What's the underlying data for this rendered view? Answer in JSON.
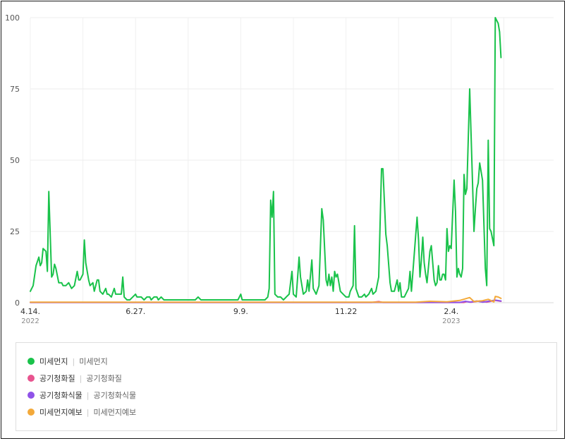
{
  "chart_data": {
    "type": "line",
    "ylim": [
      0,
      100
    ],
    "yticks": [
      "0",
      "25",
      "50",
      "75",
      "100"
    ],
    "grid": true,
    "xrange": [
      "2022-04-14",
      "2023-04-17"
    ],
    "xticks": [
      {
        "date": "2022-04-14",
        "label": "4.14.",
        "year": "2022"
      },
      {
        "date": "2022-06-27",
        "label": "6.27.",
        "year": ""
      },
      {
        "date": "2022-09-09",
        "label": "9.9.",
        "year": ""
      },
      {
        "date": "2022-11-22",
        "label": "11.22",
        "year": ""
      },
      {
        "date": "2023-02-04",
        "label": "2.4.",
        "year": "2023"
      }
    ],
    "series": [
      {
        "name": "미세먼지",
        "color": "#19c24a",
        "points": [
          [
            "2022-04-14",
            4
          ],
          [
            "2022-04-16",
            6
          ],
          [
            "2022-04-18",
            13
          ],
          [
            "2022-04-20",
            16
          ],
          [
            "2022-04-21",
            13
          ],
          [
            "2022-04-22",
            14
          ],
          [
            "2022-04-23",
            19
          ],
          [
            "2022-04-25",
            18
          ],
          [
            "2022-04-26",
            11
          ],
          [
            "2022-04-27",
            39
          ],
          [
            "2022-04-29",
            9
          ],
          [
            "2022-04-30",
            10
          ],
          [
            "2022-05-01",
            13.5
          ],
          [
            "2022-05-02",
            12
          ],
          [
            "2022-05-04",
            7
          ],
          [
            "2022-05-06",
            7
          ],
          [
            "2022-05-07",
            6
          ],
          [
            "2022-05-09",
            6
          ],
          [
            "2022-05-11",
            7
          ],
          [
            "2022-05-13",
            5
          ],
          [
            "2022-05-15",
            6
          ],
          [
            "2022-05-17",
            11
          ],
          [
            "2022-05-18",
            8
          ],
          [
            "2022-05-19",
            8
          ],
          [
            "2022-05-21",
            10
          ],
          [
            "2022-05-22",
            22
          ],
          [
            "2022-05-23",
            14
          ],
          [
            "2022-05-25",
            8
          ],
          [
            "2022-05-26",
            6
          ],
          [
            "2022-05-28",
            7
          ],
          [
            "2022-05-29",
            4
          ],
          [
            "2022-05-31",
            8
          ],
          [
            "2022-06-01",
            8
          ],
          [
            "2022-06-02",
            4
          ],
          [
            "2022-06-04",
            3
          ],
          [
            "2022-06-06",
            5
          ],
          [
            "2022-06-07",
            3
          ],
          [
            "2022-06-08",
            3
          ],
          [
            "2022-06-10",
            2
          ],
          [
            "2022-06-12",
            5
          ],
          [
            "2022-06-13",
            3
          ],
          [
            "2022-06-15",
            3
          ],
          [
            "2022-06-17",
            3
          ],
          [
            "2022-06-18",
            9
          ],
          [
            "2022-06-19",
            2
          ],
          [
            "2022-06-21",
            1
          ],
          [
            "2022-06-23",
            1
          ],
          [
            "2022-06-25",
            2
          ],
          [
            "2022-06-27",
            3
          ],
          [
            "2022-06-28",
            2
          ],
          [
            "2022-07-01",
            2
          ],
          [
            "2022-07-03",
            1
          ],
          [
            "2022-07-05",
            2
          ],
          [
            "2022-07-07",
            2
          ],
          [
            "2022-07-08",
            1
          ],
          [
            "2022-07-10",
            2
          ],
          [
            "2022-07-12",
            2
          ],
          [
            "2022-07-13",
            1
          ],
          [
            "2022-07-15",
            2
          ],
          [
            "2022-07-17",
            1
          ],
          [
            "2022-07-19",
            1
          ],
          [
            "2022-07-21",
            1
          ],
          [
            "2022-07-23",
            1
          ],
          [
            "2022-07-25",
            1
          ],
          [
            "2022-07-27",
            1
          ],
          [
            "2022-07-29",
            1
          ],
          [
            "2022-07-31",
            1
          ],
          [
            "2022-08-02",
            1
          ],
          [
            "2022-08-04",
            1
          ],
          [
            "2022-08-06",
            1
          ],
          [
            "2022-08-08",
            1
          ],
          [
            "2022-08-10",
            2
          ],
          [
            "2022-08-12",
            1
          ],
          [
            "2022-08-14",
            1
          ],
          [
            "2022-08-16",
            1
          ],
          [
            "2022-08-18",
            1
          ],
          [
            "2022-08-20",
            1
          ],
          [
            "2022-08-22",
            1
          ],
          [
            "2022-08-24",
            1
          ],
          [
            "2022-08-26",
            1
          ],
          [
            "2022-08-28",
            1
          ],
          [
            "2022-08-30",
            1
          ],
          [
            "2022-09-01",
            1
          ],
          [
            "2022-09-03",
            1
          ],
          [
            "2022-09-05",
            1
          ],
          [
            "2022-09-07",
            1
          ],
          [
            "2022-09-09",
            3
          ],
          [
            "2022-09-10",
            1
          ],
          [
            "2022-09-12",
            1
          ],
          [
            "2022-09-14",
            1
          ],
          [
            "2022-09-16",
            1
          ],
          [
            "2022-09-18",
            1
          ],
          [
            "2022-09-20",
            1
          ],
          [
            "2022-09-22",
            1
          ],
          [
            "2022-09-24",
            1
          ],
          [
            "2022-09-26",
            1
          ],
          [
            "2022-09-28",
            2
          ],
          [
            "2022-09-29",
            5
          ],
          [
            "2022-09-30",
            36
          ],
          [
            "2022-10-01",
            30
          ],
          [
            "2022-10-02",
            39
          ],
          [
            "2022-10-03",
            3
          ],
          [
            "2022-10-05",
            2
          ],
          [
            "2022-10-07",
            2
          ],
          [
            "2022-10-09",
            1
          ],
          [
            "2022-10-11",
            2
          ],
          [
            "2022-10-13",
            3
          ],
          [
            "2022-10-15",
            11
          ],
          [
            "2022-10-16",
            3
          ],
          [
            "2022-10-18",
            2
          ],
          [
            "2022-10-20",
            16
          ],
          [
            "2022-10-21",
            9
          ],
          [
            "2022-10-23",
            3
          ],
          [
            "2022-10-25",
            4
          ],
          [
            "2022-10-26",
            8
          ],
          [
            "2022-10-27",
            4
          ],
          [
            "2022-10-29",
            15
          ],
          [
            "2022-10-30",
            5
          ],
          [
            "2022-11-01",
            3
          ],
          [
            "2022-11-03",
            6
          ],
          [
            "2022-11-05",
            33
          ],
          [
            "2022-11-06",
            29
          ],
          [
            "2022-11-08",
            8
          ],
          [
            "2022-11-09",
            6
          ],
          [
            "2022-11-10",
            10
          ],
          [
            "2022-11-11",
            6
          ],
          [
            "2022-11-12",
            9
          ],
          [
            "2022-11-13",
            4
          ],
          [
            "2022-11-14",
            11
          ],
          [
            "2022-11-15",
            9
          ],
          [
            "2022-11-16",
            10
          ],
          [
            "2022-11-18",
            4
          ],
          [
            "2022-11-20",
            3
          ],
          [
            "2022-11-22",
            2
          ],
          [
            "2022-11-24",
            2
          ],
          [
            "2022-11-25",
            4
          ],
          [
            "2022-11-27",
            6
          ],
          [
            "2022-11-28",
            27
          ],
          [
            "2022-11-29",
            5
          ],
          [
            "2022-12-01",
            2
          ],
          [
            "2022-12-03",
            2
          ],
          [
            "2022-12-05",
            3
          ],
          [
            "2022-12-06",
            2
          ],
          [
            "2022-12-08",
            3
          ],
          [
            "2022-12-10",
            5
          ],
          [
            "2022-12-11",
            3
          ],
          [
            "2022-12-13",
            4
          ],
          [
            "2022-12-15",
            9
          ],
          [
            "2022-12-17",
            47
          ],
          [
            "2022-12-18",
            47
          ],
          [
            "2022-12-20",
            24
          ],
          [
            "2022-12-21",
            20
          ],
          [
            "2022-12-23",
            7
          ],
          [
            "2022-12-24",
            4
          ],
          [
            "2022-12-26",
            4
          ],
          [
            "2022-12-28",
            8
          ],
          [
            "2022-12-29",
            4
          ],
          [
            "2022-12-30",
            7
          ],
          [
            "2022-12-31",
            2
          ],
          [
            "2023-01-02",
            2
          ],
          [
            "2023-01-04",
            4
          ],
          [
            "2023-01-05",
            5
          ],
          [
            "2023-01-06",
            11
          ],
          [
            "2023-01-07",
            4
          ],
          [
            "2023-01-09",
            17
          ],
          [
            "2023-01-11",
            30
          ],
          [
            "2023-01-12",
            22
          ],
          [
            "2023-01-13",
            9
          ],
          [
            "2023-01-14",
            15
          ],
          [
            "2023-01-15",
            23
          ],
          [
            "2023-01-16",
            14
          ],
          [
            "2023-01-17",
            10
          ],
          [
            "2023-01-18",
            7
          ],
          [
            "2023-01-20",
            18
          ],
          [
            "2023-01-21",
            20
          ],
          [
            "2023-01-23",
            8
          ],
          [
            "2023-01-24",
            6
          ],
          [
            "2023-01-25",
            7
          ],
          [
            "2023-01-26",
            13
          ],
          [
            "2023-01-27",
            8
          ],
          [
            "2023-01-28",
            8
          ],
          [
            "2023-01-29",
            10
          ],
          [
            "2023-01-30",
            10
          ],
          [
            "2023-01-31",
            8
          ],
          [
            "2023-02-01",
            26
          ],
          [
            "2023-02-02",
            18
          ],
          [
            "2023-02-03",
            20
          ],
          [
            "2023-02-04",
            19
          ],
          [
            "2023-02-06",
            43
          ],
          [
            "2023-02-07",
            32
          ],
          [
            "2023-02-08",
            9
          ],
          [
            "2023-02-09",
            12
          ],
          [
            "2023-02-10",
            10
          ],
          [
            "2023-02-11",
            9
          ],
          [
            "2023-02-12",
            12
          ],
          [
            "2023-02-13",
            45
          ],
          [
            "2023-02-14",
            38
          ],
          [
            "2023-02-15",
            40
          ],
          [
            "2023-02-17",
            75
          ],
          [
            "2023-02-18",
            58
          ],
          [
            "2023-02-20",
            25
          ],
          [
            "2023-02-21",
            33
          ],
          [
            "2023-02-22",
            40
          ],
          [
            "2023-02-23",
            42
          ],
          [
            "2023-02-24",
            49
          ],
          [
            "2023-02-26",
            43
          ],
          [
            "2023-02-28",
            12
          ],
          [
            "2023-03-01",
            6
          ],
          [
            "2023-03-02",
            57
          ],
          [
            "2023-03-03",
            26
          ],
          [
            "2023-03-04",
            25
          ],
          [
            "2023-03-06",
            20
          ],
          [
            "2023-03-07",
            100
          ],
          [
            "2023-03-09",
            98
          ],
          [
            "2023-03-10",
            95
          ],
          [
            "2023-03-11",
            86
          ]
        ]
      },
      {
        "name": "공기청화질",
        "color": "#e8548f",
        "points": [
          [
            "2022-04-14",
            0.1
          ],
          [
            "2022-12-10",
            0.1
          ],
          [
            "2022-12-15",
            0.4
          ],
          [
            "2022-12-18",
            0.1
          ],
          [
            "2023-02-13",
            0.1
          ],
          [
            "2023-02-15",
            0.4
          ],
          [
            "2023-02-18",
            0.2
          ],
          [
            "2023-02-24",
            0.6
          ],
          [
            "2023-03-01",
            0.2
          ],
          [
            "2023-03-07",
            0.8
          ],
          [
            "2023-03-11",
            0.5
          ]
        ]
      },
      {
        "name": "공기청화식물",
        "color": "#8f52e8",
        "points": [
          [
            "2022-04-14",
            0.1
          ],
          [
            "2023-02-10",
            0.1
          ],
          [
            "2023-02-14",
            0.5
          ],
          [
            "2023-02-17",
            0.2
          ],
          [
            "2023-02-22",
            0.6
          ],
          [
            "2023-02-26",
            0.2
          ],
          [
            "2023-03-02",
            0.5
          ],
          [
            "2023-03-07",
            0.9
          ],
          [
            "2023-03-11",
            0.6
          ]
        ]
      },
      {
        "name": "미세먼지예보",
        "color": "#f3a93a",
        "points": [
          [
            "2022-04-14",
            0.2
          ],
          [
            "2023-01-10",
            0.2
          ],
          [
            "2023-01-20",
            0.5
          ],
          [
            "2023-02-01",
            0.3
          ],
          [
            "2023-02-10",
            0.8
          ],
          [
            "2023-02-17",
            1.8
          ],
          [
            "2023-02-20",
            0.4
          ],
          [
            "2023-02-26",
            0.7
          ],
          [
            "2023-03-02",
            1.2
          ],
          [
            "2023-03-06",
            0.3
          ],
          [
            "2023-03-07",
            2.2
          ],
          [
            "2023-03-09",
            2.0
          ],
          [
            "2023-03-11",
            1.5
          ]
        ]
      }
    ]
  },
  "legend": [
    {
      "name": "미세먼지",
      "desc": "미세먼지",
      "color": "#19c24a",
      "icon": "green-dot-icon"
    },
    {
      "name": "공기청화질",
      "desc": "공기청화질",
      "color": "#e8548f",
      "icon": "pink-dot-icon"
    },
    {
      "name": "공기청화식물",
      "desc": "공기청화식물",
      "color": "#8f52e8",
      "icon": "purple-dot-icon"
    },
    {
      "name": "미세먼지예보",
      "desc": "미세먼지예보",
      "color": "#f3a93a",
      "icon": "orange-dot-icon"
    }
  ],
  "legend_separator": "|"
}
